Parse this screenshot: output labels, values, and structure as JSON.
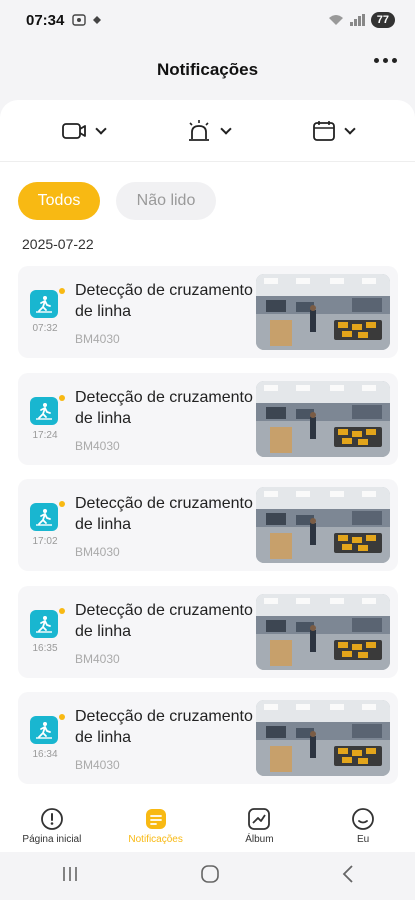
{
  "status": {
    "time": "07:34",
    "battery": "77"
  },
  "header": {
    "title": "Notificações"
  },
  "tabs": [
    {
      "label": "Todos",
      "active": true
    },
    {
      "label": "Não lido",
      "active": false
    }
  ],
  "date_group": "2025-07-22",
  "notifications": [
    {
      "title": "Detecção de cruzamento de linha",
      "device": "BM4030",
      "time": "07:32",
      "unread": true
    },
    {
      "title": "Detecção de cruzamento de linha",
      "device": "BM4030",
      "time": "17:24",
      "unread": true
    },
    {
      "title": "Detecção de cruzamento de linha",
      "device": "BM4030",
      "time": "17:02",
      "unread": true
    },
    {
      "title": "Detecção de cruzamento de linha",
      "device": "BM4030",
      "time": "16:35",
      "unread": true
    },
    {
      "title": "Detecção de cruzamento de linha",
      "device": "BM4030",
      "time": "16:34",
      "unread": true
    }
  ],
  "bottom_nav": [
    {
      "label": "Página inicial",
      "icon": "home-icon",
      "active": false
    },
    {
      "label": "Notificações",
      "icon": "notifications-icon",
      "active": true
    },
    {
      "label": "Álbum",
      "icon": "album-icon",
      "active": false
    },
    {
      "label": "Eu",
      "icon": "profile-icon",
      "active": false
    }
  ],
  "colors": {
    "accent": "#f8b913",
    "event_icon": "#19b6d0"
  }
}
